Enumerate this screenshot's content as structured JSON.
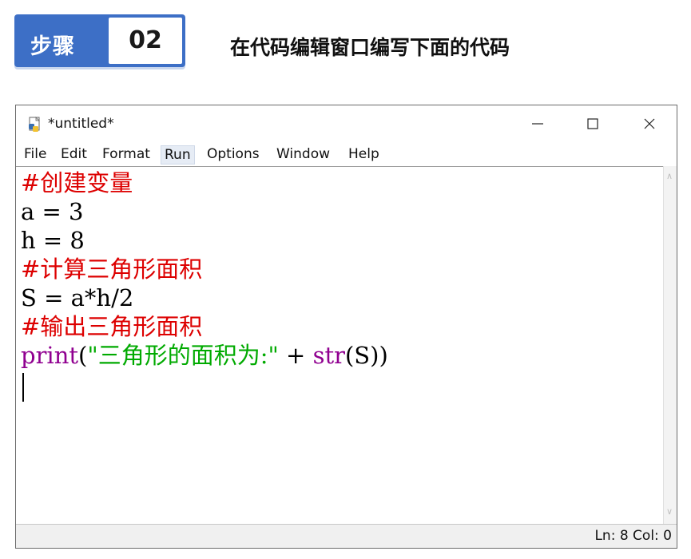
{
  "step": {
    "label": "步骤",
    "number": "02",
    "description": "在代码编辑窗口编写下面的代码"
  },
  "window": {
    "title": "*untitled*",
    "controls": {
      "minimize": "minimize",
      "maximize": "maximize",
      "close": "close"
    }
  },
  "menu": {
    "items": [
      "File",
      "Edit",
      "Format",
      "Run",
      "Options",
      "Window",
      "Help"
    ],
    "active": "Run"
  },
  "code": {
    "line1": "#创建变量",
    "line2": "a = 3",
    "line3": "h = 8",
    "line4": "#计算三角形面积",
    "line5": "S = a*h/2",
    "line6": "#输出三角形面积",
    "line7_func": "print",
    "line7_paren_open": "(",
    "line7_string": "\"三角形的面积为:\"",
    "line7_plus": " + ",
    "line7_builtin": "str",
    "line7_tail": "(S))"
  },
  "status": {
    "text": "Ln: 8  Col: 0"
  },
  "colors": {
    "step_blue": "#3d6fc6",
    "comment": "#dd0000",
    "string": "#00aa00",
    "builtin": "#900090"
  },
  "icons": [
    "python-file-icon",
    "minimize-icon",
    "maximize-icon",
    "close-icon",
    "scroll-up-icon",
    "scroll-down-icon"
  ]
}
